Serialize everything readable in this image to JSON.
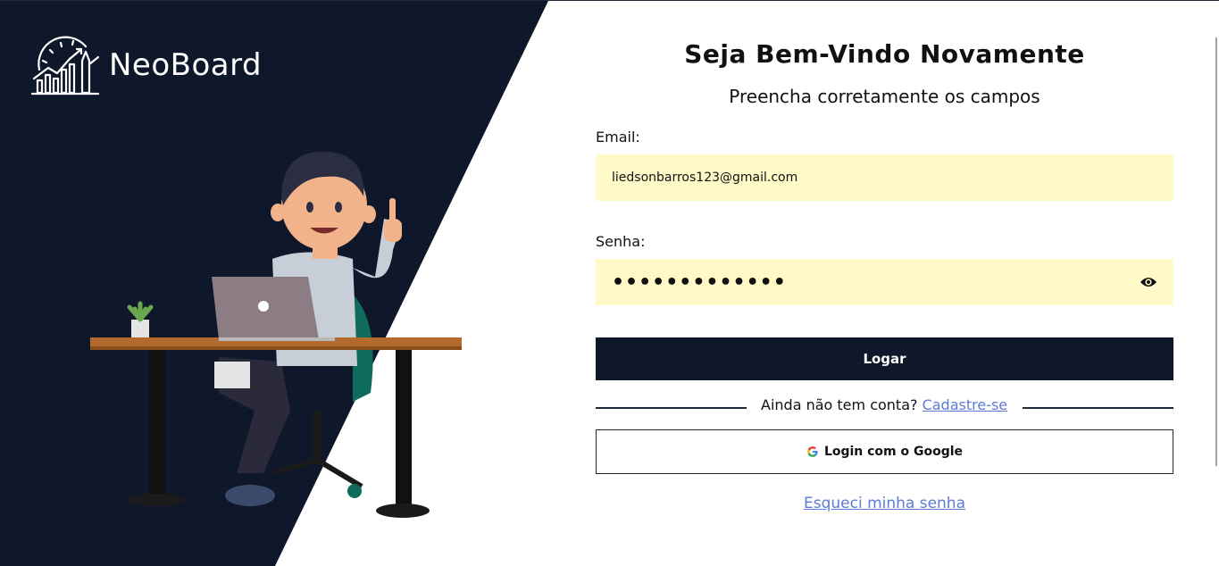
{
  "brand": {
    "name": "NeoBoard"
  },
  "form": {
    "title": "Seja Bem-Vindo Novamente",
    "subtitle": "Preencha corretamente os campos",
    "email_label": "Email:",
    "email_value": "liedsonbarros123@gmail.com",
    "password_label": "Senha:",
    "password_value": "•••••••••••••",
    "login_button": "Logar",
    "no_account_text": "Ainda não tem conta?",
    "signup_link": "Cadastre-se",
    "google_button": "Login com o Google",
    "forgot_link": "Esqueci minha senha"
  },
  "icons": {
    "logo": "chart-growth-logo-icon",
    "eye": "eye-icon",
    "google": "google-icon"
  },
  "colors": {
    "dark": "#0f172a",
    "input_bg": "#fffac8",
    "link": "#5b7bd5"
  }
}
